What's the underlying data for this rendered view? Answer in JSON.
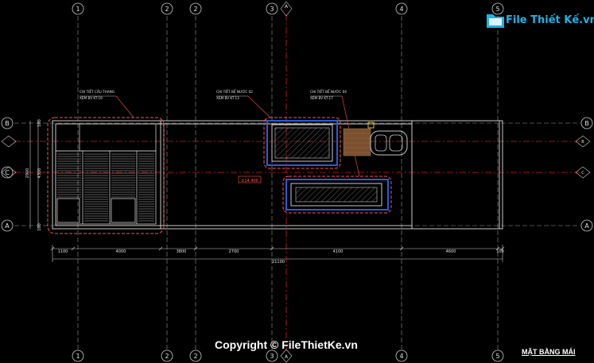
{
  "watermark": {
    "logo_text": "File Thiết Kế.vn",
    "copyright": "Copyright © FileThietKe.vn"
  },
  "drawing": {
    "sheet_title": "MẶT BẰNG MÁI",
    "level_tag": "±14.400"
  },
  "grid_columns": [
    "1",
    "2",
    "2",
    "3",
    "4",
    "5"
  ],
  "grid_rows": [
    "B",
    "C",
    "A"
  ],
  "section_marks": {
    "top": "A",
    "bottom": "A",
    "right": "B",
    "right2": "C"
  },
  "callouts": [
    {
      "line1": "CHI TIẾT CẦU THANG",
      "line2": "XEM BV KT-19"
    },
    {
      "line1": "CHI TIẾT BỂ NƯỚC 02",
      "line2": "XEM BV KT-13"
    },
    {
      "line1": "CHI TIẾT BỂ NƯỚC 04",
      "line2": "XEM BV KT-17"
    }
  ],
  "dims_bottom": [
    "1100",
    "4000",
    "3800",
    "2700",
    "4100",
    "4600",
    "100"
  ],
  "dim_total": "21100",
  "dims_left": [
    "100",
    "2900",
    "4300",
    "100"
  ],
  "colors": {
    "grid_red": "#d01c1c",
    "wall": "#c8c8c8",
    "callout": "#ff5050",
    "blue": "#2a5bd8",
    "accent": "#1fb3e6"
  }
}
